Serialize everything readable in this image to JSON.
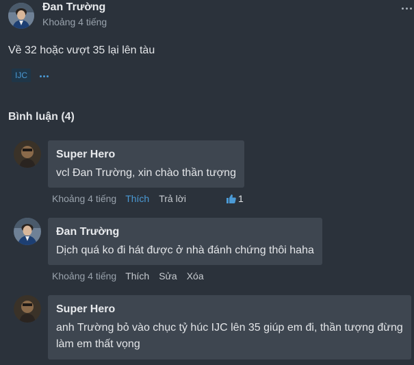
{
  "post": {
    "author": "Đan Trường",
    "time": "Khoảng 4 tiếng",
    "text": "Về 32 hoặc vượt 35 lại lên tàu",
    "tag": "IJC",
    "menu_icon": "more-dots-icon"
  },
  "comments_heading": "Bình luận (4)",
  "comments": [
    {
      "author": "Super Hero",
      "text": "vcl Đan Trường, xin chào thần tượng",
      "time": "Khoảng 4 tiếng",
      "actions": [
        "Thích",
        "Trả lời"
      ],
      "liked": true,
      "likes": "1"
    },
    {
      "author": "Đan Trường",
      "text": "Dịch quá ko đi hát được ở nhà đánh chứng thôi haha",
      "time": "Khoảng 4 tiếng",
      "actions": [
        "Thích",
        "Sửa",
        "Xóa"
      ]
    },
    {
      "author": "Super Hero",
      "text": "anh Trường bỏ vào chục tỷ húc IJC lên 35 giúp em đi, thần tượng đừng làm em thất vọng"
    }
  ],
  "colors": {
    "background": "#2b323b",
    "bubble": "#3e4650",
    "accent": "#4b9ad5",
    "muted": "#9aa3ad"
  }
}
